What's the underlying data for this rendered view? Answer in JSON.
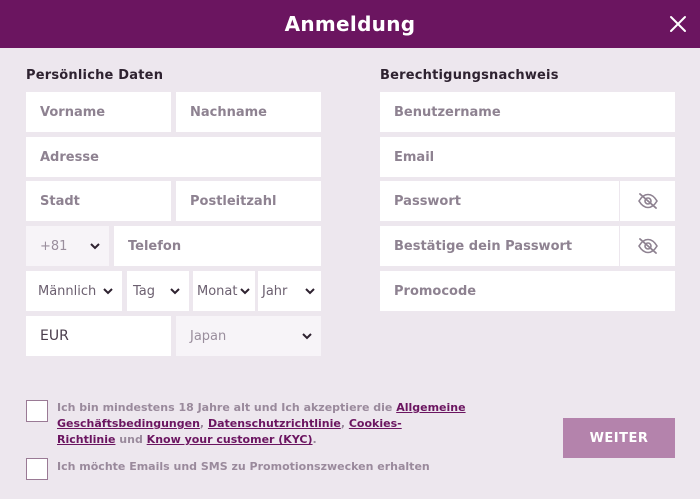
{
  "header": {
    "title": "Anmeldung"
  },
  "personal": {
    "section_title": "Persönliche Daten",
    "first_name_placeholder": "Vorname",
    "last_name_placeholder": "Nachname",
    "address_placeholder": "Adresse",
    "city_placeholder": "Stadt",
    "zip_placeholder": "Postleitzahl",
    "phone_prefix": "+81",
    "phone_placeholder": "Telefon",
    "gender": "Männlich",
    "day": "Tag",
    "month": "Monat",
    "year": "Jahr",
    "currency": "EUR",
    "country": "Japan"
  },
  "credentials": {
    "section_title": "Berechtigungsnachweis",
    "username_placeholder": "Benutzername",
    "email_placeholder": "Email",
    "password_placeholder": "Passwort",
    "confirm_password_placeholder": "Bestätige dein Passwort",
    "promo_placeholder": "Promocode"
  },
  "consent": {
    "terms_prefix": "Ich bin mindestens 18 Jahre alt und Ich akzeptiere die ",
    "link_terms_1": "Allgemeine",
    "link_terms_2": "Geschäftsbedingungen",
    "sep1": ", ",
    "link_privacy": "Datenschutzrichtlinie",
    "sep2": ", ",
    "link_cookies_1": "Cookies-",
    "link_cookies_2": "Richtlinie",
    "and": " und ",
    "link_kyc": "Know your customer (KYC)",
    "end": ".",
    "marketing": "Ich möchte Emails und SMS zu Promotionszwecken erhalten"
  },
  "actions": {
    "next_label": "WEITER"
  },
  "colors": {
    "header": "#6b1560",
    "background": "#ede7ee",
    "button": "#b483ac",
    "link": "#6b1560"
  },
  "icons": {
    "close": "close-icon",
    "eye": "eye-off-icon",
    "chevron": "chevron-down-icon"
  }
}
